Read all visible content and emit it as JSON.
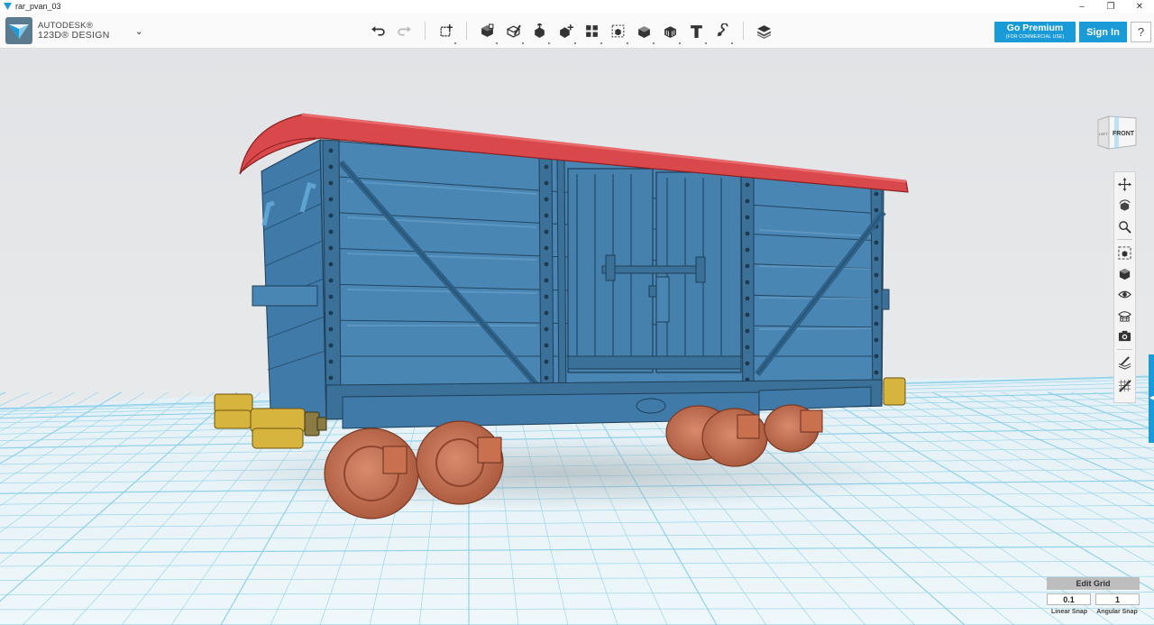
{
  "window": {
    "title": "rar_pvan_03",
    "controls": {
      "minimize": "–",
      "maximize": "❐",
      "close": "✕"
    }
  },
  "brand": {
    "line1": "AUTODESK®",
    "line2": "123D® DESIGN",
    "icon": "autodesk-123d-logo"
  },
  "toolbar": {
    "undo_icon": "undo-icon",
    "redo_icon": "redo-icon",
    "tools": [
      "transform-icon",
      "primitives-icon",
      "sketch-icon",
      "construct-icon",
      "modify-icon",
      "pattern-icon",
      "grouping-icon",
      "combine-icon",
      "measure-icon",
      "text-icon",
      "snap-icon",
      "material-icon"
    ],
    "text_tool_glyph": "T"
  },
  "account": {
    "premium_label": "Go Premium",
    "premium_sublabel": "(FOR COMMERCIAL USE)",
    "signin_label": "Sign In",
    "help_label": "?"
  },
  "viewcube": {
    "front_label": "FRONT",
    "left_label": "LEFT"
  },
  "navbar": {
    "items": [
      "pan-icon",
      "orbit-icon",
      "zoom-icon",
      "fit-icon",
      "view-icon",
      "visibility-icon",
      "materials-outlines-icon",
      "camera-icon",
      "snap-grid-icon",
      "hide-grid-icon"
    ]
  },
  "grid_panel": {
    "title": "Edit Grid",
    "linear_snap_value": "0.1",
    "angular_snap_value": "1",
    "linear_snap_label": "Linear Snap",
    "angular_snap_label": "Angular Snap"
  },
  "colors": {
    "accent": "#1a9bd7",
    "body": "#4a86b4",
    "roof": "#d9484a",
    "wheels": "#c97558",
    "buffers": "#d6b43e",
    "grid_line": "#8fd1ea",
    "grid_floor": "#e8f3f7",
    "background": "#e4e6e8"
  }
}
